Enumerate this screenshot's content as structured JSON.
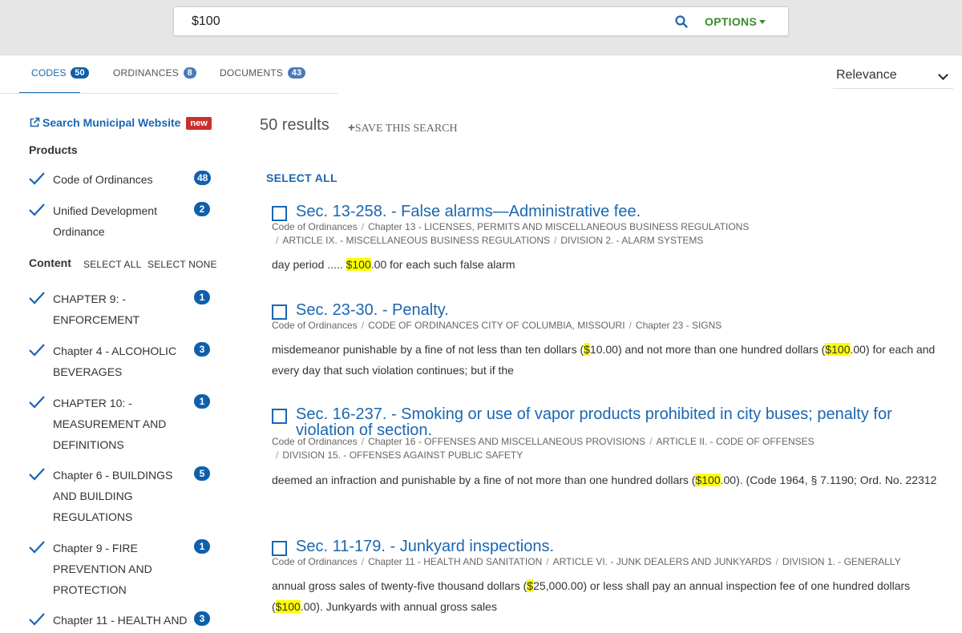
{
  "search": {
    "query": "$100",
    "options_label": "OPTIONS"
  },
  "tabs": [
    {
      "label": "CODES",
      "count": "50"
    },
    {
      "label": "ORDINANCES",
      "count": "8"
    },
    {
      "label": "DOCUMENTS",
      "count": "43"
    }
  ],
  "sort": {
    "value": "Relevance"
  },
  "sidebar": {
    "external_link": "Search Municipal Website",
    "new_badge": "new",
    "products_heading": "Products",
    "products": [
      {
        "label": "Code of Ordinances",
        "count": "48"
      },
      {
        "label": "Unified Development Ordinance",
        "count": "2"
      }
    ],
    "content_heading": "Content",
    "select_all": "SELECT ALL",
    "select_none": "SELECT NONE",
    "content": [
      {
        "label": "CHAPTER 9: - ENFORCEMENT",
        "count": "1"
      },
      {
        "label": "Chapter 4 - ALCOHOLIC BEVERAGES",
        "count": "3"
      },
      {
        "label": "CHAPTER 10: - MEASUREMENT AND DEFINITIONS",
        "count": "1"
      },
      {
        "label": "Chapter 6 - BUILDINGS AND BUILDING REGULATIONS",
        "count": "5"
      },
      {
        "label": "Chapter 9 - FIRE PREVENTION AND PROTECTION",
        "count": "1"
      },
      {
        "label": "Chapter 11 - HEALTH AND",
        "count": "3"
      }
    ]
  },
  "results": {
    "count_text": "50 results",
    "save_search": "SAVE THIS SEARCH",
    "select_all": "SELECT ALL",
    "items": [
      {
        "title": "Sec. 13-258. - False alarms—Administrative fee.",
        "crumbs_line1": [
          "Code of Ordinances",
          "Chapter 13 - LICENSES, PERMITS AND MISCELLANEOUS BUSINESS REGULATIONS"
        ],
        "crumbs_line2": [
          "ARTICLE IX. - MISCELLANEOUS BUSINESS REGULATIONS",
          "DIVISION 2. - ALARM SYSTEMS"
        ],
        "snippet_parts": [
          "day period ..... ",
          "$100",
          ".00 for each such false alarm"
        ]
      },
      {
        "title": "Sec. 23-30. - Penalty.",
        "crumbs_line1": [
          "Code of Ordinances",
          "CODE OF ORDINANCES CITY OF COLUMBIA, MISSOURI",
          "Chapter 23 - SIGNS"
        ],
        "crumbs_line2": [],
        "snippet_parts": [
          "misdemeanor punishable by a fine of not less than ten dollars (",
          "$",
          "10.00) and not more than one hundred dollars (",
          "$100",
          ".00) for each and every day that such violation continues; but if the"
        ]
      },
      {
        "title": "Sec. 16-237. - Smoking or use of vapor products prohibited in city buses; penalty for violation of section.",
        "crumbs_line1": [
          "Code of Ordinances",
          "Chapter 16 - OFFENSES AND MISCELLANEOUS PROVISIONS",
          "ARTICLE II. - CODE OF OFFENSES"
        ],
        "crumbs_line2": [
          "DIVISION 15. - OFFENSES AGAINST PUBLIC SAFETY"
        ],
        "snippet_parts": [
          "deemed an infraction and punishable by a fine of not more than one hundred dollars (",
          "$100",
          ".00). (Code 1964, § 7.1190; Ord. No. 22312"
        ]
      },
      {
        "title": "Sec. 11-179. - Junkyard inspections.",
        "crumbs_line1": [
          "Code of Ordinances",
          "Chapter 11 - HEALTH AND SANITATION",
          "ARTICLE VI. - JUNK DEALERS AND JUNKYARDS",
          "DIVISION 1. - GENERALLY"
        ],
        "crumbs_line2": [],
        "snippet_parts": [
          "annual gross sales of twenty-five thousand dollars (",
          "$",
          "25,000.00) or less shall pay an annual inspection fee of one hundred dollars (",
          "$100",
          ".00). Junkyards with annual gross sales"
        ]
      }
    ]
  },
  "colors": {
    "accent": "#1b66b1",
    "options_green": "#3a8a2e",
    "badge_blue": "#0f5fab",
    "new_red": "#c9302c",
    "highlight": "#ffff00"
  }
}
